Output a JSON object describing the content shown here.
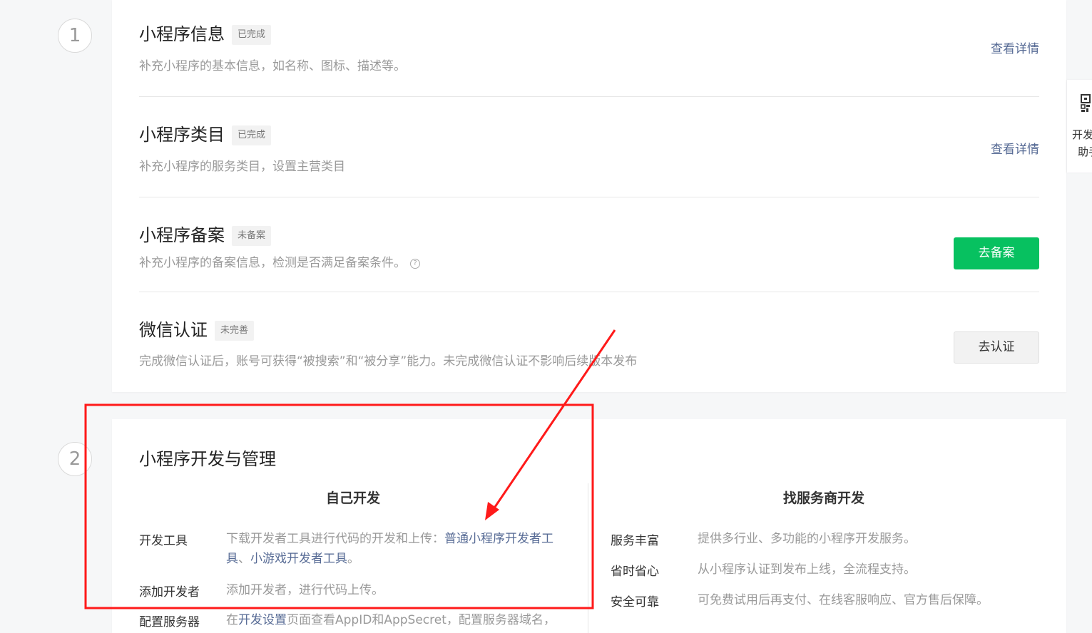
{
  "steps": {
    "one": "1",
    "two": "2"
  },
  "section1": {
    "rows": [
      {
        "title": "小程序信息",
        "badge": "已完成",
        "desc": "补充小程序的基本信息，如名称、图标、描述等。",
        "action": "查看详情"
      },
      {
        "title": "小程序类目",
        "badge": "已完成",
        "desc": "补充小程序的服务类目，设置主营类目",
        "action": "查看详情"
      },
      {
        "title": "小程序备案",
        "badge": "未备案",
        "desc": "补充小程序的备案信息，检测是否满足备案条件。",
        "help": "?",
        "action": "去备案"
      },
      {
        "title": "微信认证",
        "badge": "未完善",
        "desc": "完成微信认证后，账号可获得“被搜索”和“被分享”能力。未完成微信认证不影响后续版本发布",
        "action": "去认证"
      }
    ]
  },
  "section2": {
    "title": "小程序开发与管理",
    "self_dev": {
      "heading": "自己开发",
      "items": [
        {
          "label": "开发工具",
          "desc_prefix": "下载开发者工具进行代码的开发和上传：",
          "link1": "普通小程序开发者工具",
          "sep": "、",
          "link2": "小游戏开发者工具",
          "suffix": "。"
        },
        {
          "label": "添加开发者",
          "desc": "添加开发者，进行代码上传。"
        },
        {
          "label": "配置服务器",
          "desc_prefix": "在",
          "link": "开发设置",
          "desc_suffix": "页面查看AppID和AppSecret，配置服务器域名，"
        }
      ]
    },
    "vendor_dev": {
      "heading": "找服务商开发",
      "items": [
        {
          "label": "服务丰富",
          "desc": "提供多行业、多功能的小程序开发服务。"
        },
        {
          "label": "省时省心",
          "desc": "从小程序认证到发布上线，全流程支持。"
        },
        {
          "label": "安全可靠",
          "desc": "可免费试用后再支付、在线客服响应、官方售后保障。"
        }
      ]
    }
  },
  "side_panel": {
    "line1": "开发",
    "line2": "助手"
  },
  "colors": {
    "accent": "#07c160",
    "link": "#576b95",
    "annotation": "#ff1a1a"
  }
}
